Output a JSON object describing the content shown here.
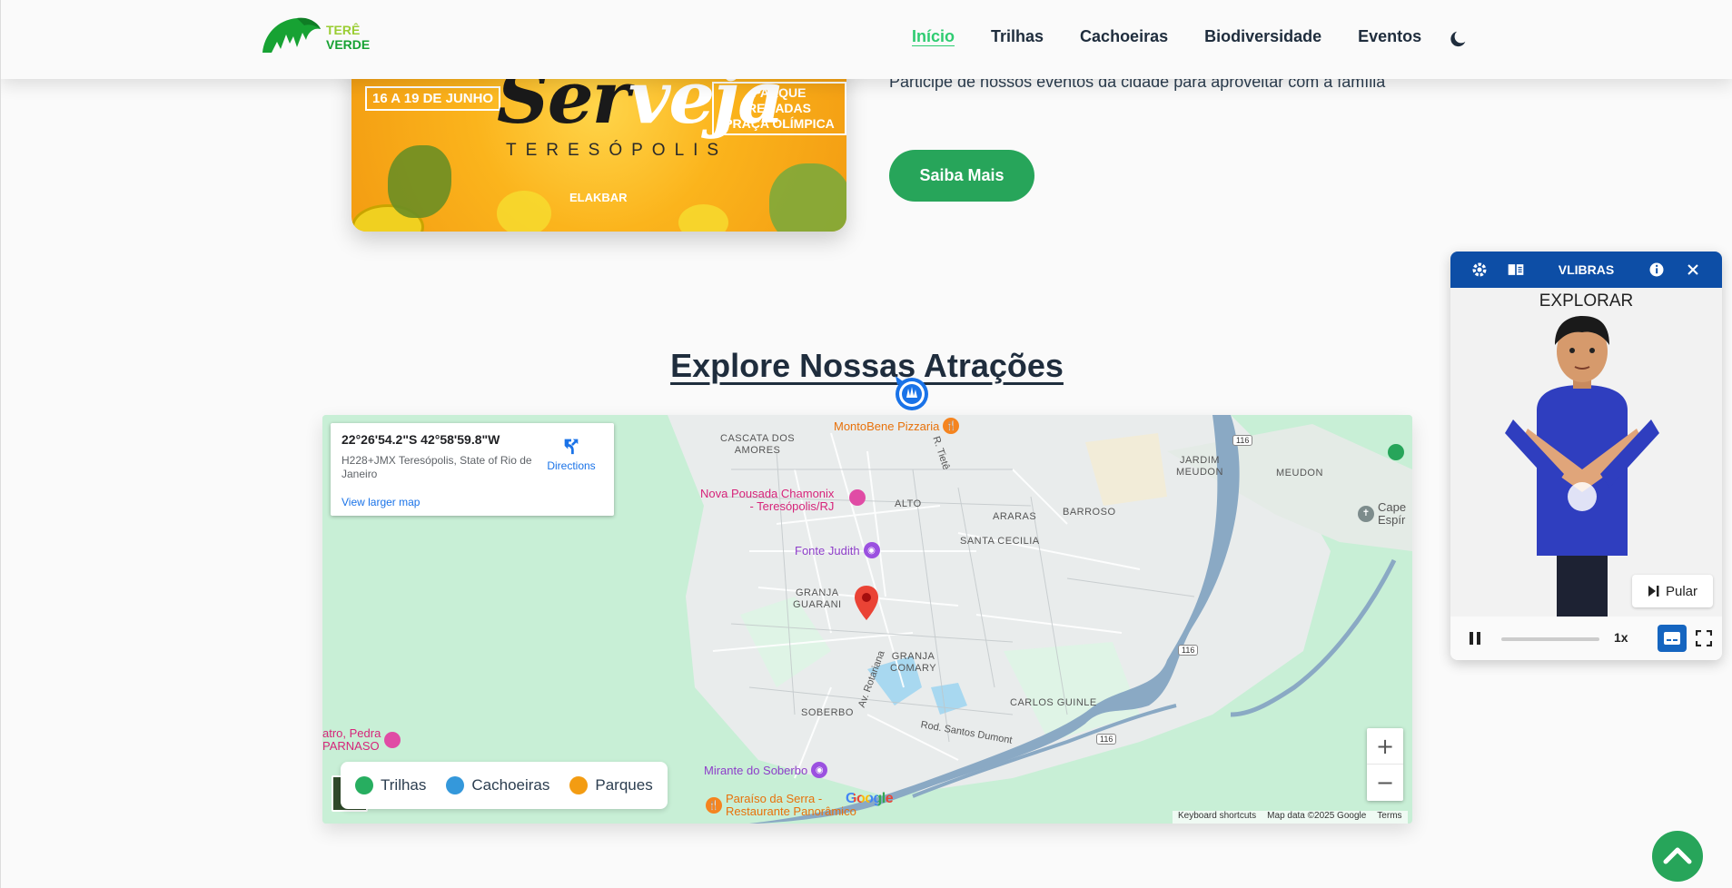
{
  "brand": {
    "line1": "TERÊ",
    "line2": "VERDE"
  },
  "nav": {
    "items": [
      "Início",
      "Trilhas",
      "Cachoeiras",
      "Biodiversidade",
      "Eventos"
    ],
    "active_index": 0
  },
  "event": {
    "date_badge": "16 A 19 DE JUNHO",
    "place_badge_1": "PARQUE REGADAS",
    "place_badge_2": "PRAÇA OLÍMPICA",
    "script_title_1": "Ser",
    "script_title_2": "veja",
    "city": "TERESÓPOLIS",
    "sponsor": "ELAKBAR",
    "description": "Participe de nossos eventos da cidade para aproveitar com a família",
    "cta": "Saiba Mais"
  },
  "section": {
    "title": "Explore Nossas Atrações"
  },
  "map": {
    "coords": "22°26'54.2\"S 42°58'59.8\"W",
    "address": "H228+JMX Teresópolis, State of Rio de Janeiro",
    "directions": "Directions",
    "view_larger": "View larger map",
    "neighborhoods": [
      {
        "label": "CASCATA DOS\nAMORES"
      },
      {
        "label": "ALTO"
      },
      {
        "label": "ARARAS"
      },
      {
        "label": "JARDIM\nMEUDON"
      },
      {
        "label": "MEUDON"
      },
      {
        "label": "BARROSO"
      },
      {
        "label": "SANTA CECILIA"
      },
      {
        "label": "GRANJA\nGUARANI"
      },
      {
        "label": "GRANJA\nCOMARY"
      },
      {
        "label": "SOBERBO"
      },
      {
        "label": "CARLOS GUINLE"
      }
    ],
    "pois": {
      "pizzaria": "MontoBene Pizzaria",
      "pousada_1": "Nova Pousada Chamonix",
      "pousada_2": "- Teresópolis/RJ",
      "fonte": "Fonte Judith",
      "mirante": "Mirante do Soberbo",
      "paraiso_1": "Paraíso da Serra -",
      "paraiso_2": "Restaurante Panorâmico",
      "teatro_1": "atro, Pedra",
      "teatro_2": "PARNASO",
      "cape_1": "Cape",
      "cape_2": "Espír"
    },
    "roads": {
      "tiete": "R. Tietê",
      "rotariana": "Av. Rotariana",
      "santos_dumont": "Rod. Santos Dumont"
    },
    "shields": [
      "116",
      "116",
      "116"
    ],
    "legend": [
      {
        "label": "Trilhas",
        "color": "#27ae60"
      },
      {
        "label": "Cachoeiras",
        "color": "#3498db"
      },
      {
        "label": "Parques",
        "color": "#f39c12"
      }
    ],
    "zoom_in": "+",
    "zoom_out": "−",
    "google": "Google",
    "attribution": [
      "Keyboard shortcuts",
      "Map data ©2025 Google",
      "Terms"
    ]
  },
  "vlibras": {
    "title": "VLIBRAS",
    "word": "EXPLORAR",
    "skip": "Pular",
    "speed": "1x"
  },
  "colors": {
    "accent": "#27a55a",
    "nav_active": "#2ecc71",
    "vlibras_blue": "#0d4ea6"
  }
}
